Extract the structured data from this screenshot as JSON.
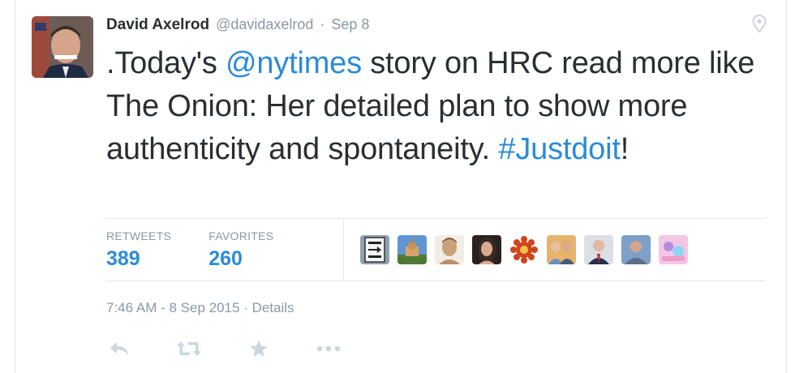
{
  "tweet": {
    "author_name": "David Axelrod",
    "handle": "@davidaxelrod",
    "separator": "·",
    "date": "Sep 8",
    "text_parts": [
      {
        "text": ".Today's ",
        "link": false
      },
      {
        "text": "@nytimes",
        "link": true
      },
      {
        "text": " story on HRC read more like The Onion: Her detailed plan to show more authenticity and spontaneity. ",
        "link": false
      },
      {
        "text": "#Justdoit",
        "link": true
      },
      {
        "text": "!",
        "link": false
      }
    ],
    "retweets_label": "RETWEETS",
    "retweets_count": "389",
    "favorites_label": "FAVORITES",
    "favorites_count": "260",
    "timestamp": "7:46 AM - 8 Sep 2015",
    "details_label": "Details",
    "favoriter_avatars": [
      "keep-right-sign-avatar",
      "building-avatar",
      "bust-avatar",
      "woman-avatar",
      "emblem-avatar",
      "group-avatar",
      "man-in-suit-avatar",
      "man-outdoor-avatar",
      "colorful-avatar"
    ],
    "icons": [
      "location-pin-icon",
      "reply-icon",
      "retweet-icon",
      "favorite-star-icon",
      "more-icon"
    ]
  },
  "colors": {
    "link": "#2b8bd6",
    "text": "#292f33",
    "muted": "#8899a6",
    "border": "#e1e8ed"
  }
}
